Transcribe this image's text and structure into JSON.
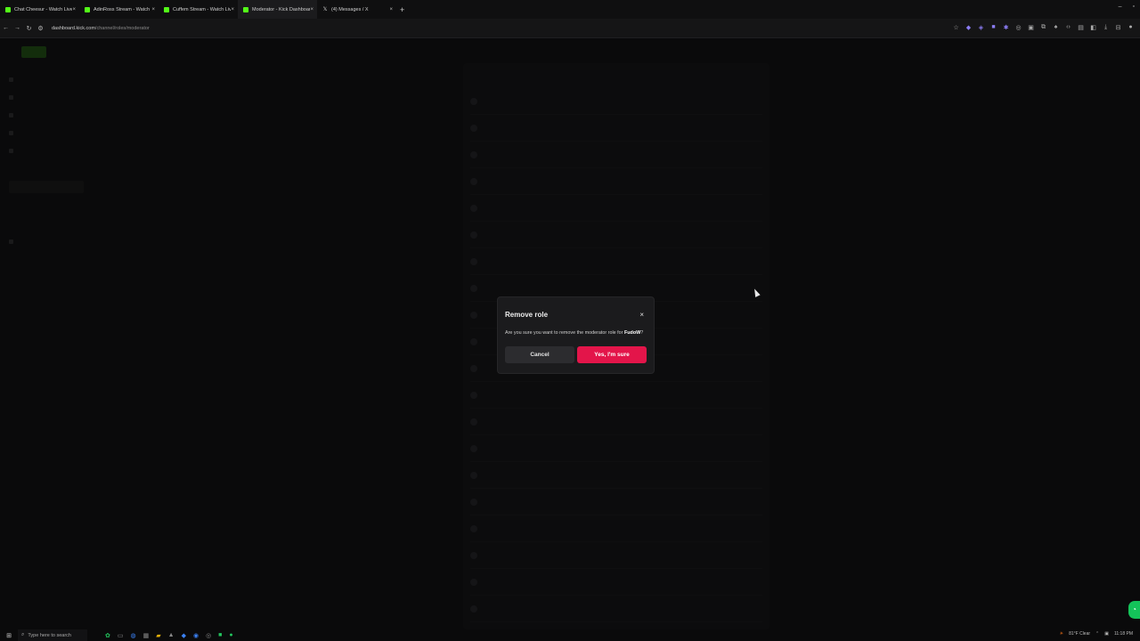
{
  "browser": {
    "tabs": [
      {
        "label": "Chat Cheesur - Watch Live on",
        "icon": "kick-favicon",
        "active": false
      },
      {
        "label": "AdinRoss Stream - Watch Live",
        "icon": "kick-favicon",
        "active": false
      },
      {
        "label": "Cuffem Stream - Watch Live o",
        "icon": "kick-favicon",
        "active": false
      },
      {
        "label": "Moderator - Kick Dashboard",
        "icon": "kick-favicon",
        "active": true
      },
      {
        "label": "(4) Messages / X",
        "icon": "x-favicon",
        "active": false
      }
    ],
    "new_tab": "+",
    "tab_close": "×",
    "url_host": "dashboard.kick.com",
    "url_path": "/channel/roles/moderator"
  },
  "modal": {
    "title": "Remove role",
    "close": "×",
    "message_prefix": "Are you sure you want to remove the moderator role for ",
    "username": "FudoW",
    "message_suffix": "?",
    "cancel_label": "Cancel",
    "confirm_label": "Yes, I'm sure"
  },
  "taskbar": {
    "search_placeholder": "Type here to search",
    "weather": "81°F Clear",
    "time": "11:18 PM"
  },
  "colors": {
    "brand_green": "#53fc18",
    "confirm_red": "#e3154a",
    "modal_bg": "#1b1b1d"
  }
}
